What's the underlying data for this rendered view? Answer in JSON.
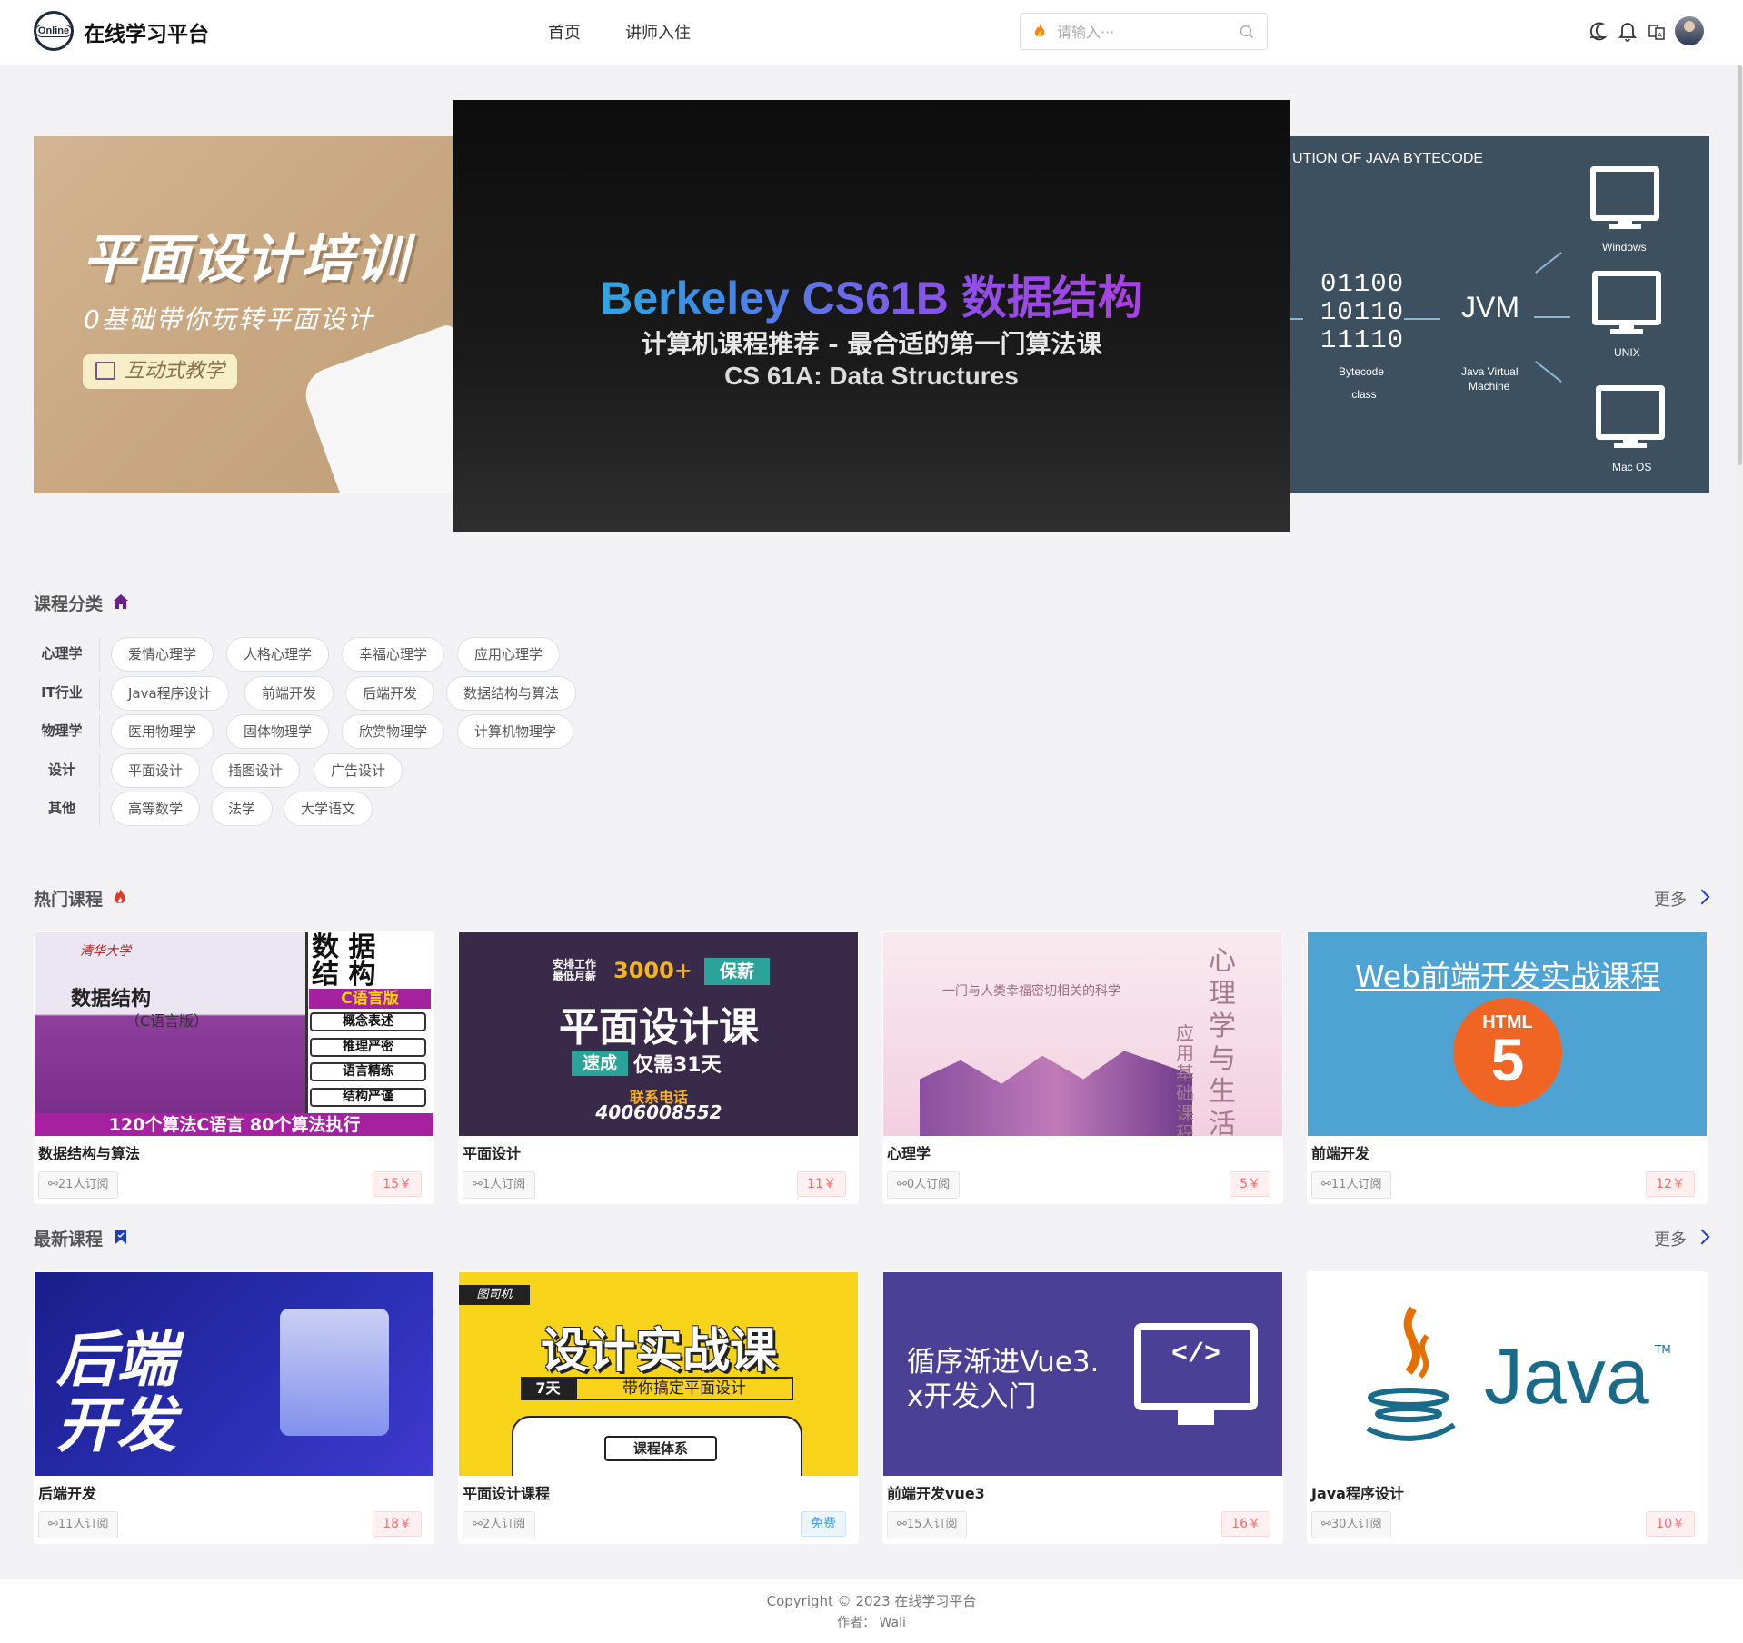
{
  "header": {
    "logo_text": "Online",
    "site_title": "在线学习平台",
    "nav": {
      "home": "首页",
      "teacher": "讲师入住"
    },
    "search_placeholder": "请输入···"
  },
  "carousel": {
    "left": {
      "title": "平面设计培训",
      "subtitle": "0基础带你玩转平面设计",
      "badge": "互动式教学"
    },
    "center": {
      "title": "Berkeley CS61B 数据结构",
      "line2": "计算机课程推荐 - 最合适的第一门算法课",
      "line3": "CS 61A: Data Structures"
    },
    "right": {
      "title": "UTION OF JAVA BYTECODE",
      "bits": [
        "01100",
        "10110",
        "11110"
      ],
      "bytecode": "Bytecode",
      "class": ".class",
      "jvm": "JVM",
      "jvm_sub": "Java Virtual",
      "jvm_sub2": "Machine",
      "os": [
        "Windows",
        "UNIX",
        "Mac OS"
      ]
    }
  },
  "categories": {
    "title": "课程分类",
    "rows": [
      {
        "name": "心理学",
        "tags": [
          "爱情心理学",
          "人格心理学",
          "幸福心理学",
          "应用心理学"
        ]
      },
      {
        "name": "IT行业",
        "tags": [
          "Java程序设计",
          "前端开发",
          "后端开发",
          "数据结构与算法"
        ]
      },
      {
        "name": "物理学",
        "tags": [
          "医用物理学",
          "固体物理学",
          "欣赏物理学",
          "计算机物理学"
        ]
      },
      {
        "name": "设计",
        "tags": [
          "平面设计",
          "插图设计",
          "广告设计"
        ]
      },
      {
        "name": "其他",
        "tags": [
          "高等数学",
          "法学",
          "大学语文"
        ]
      }
    ]
  },
  "hot": {
    "title": "热门课程",
    "more": "更多",
    "courses": [
      {
        "name": "数据结构与算法",
        "subs": "21人订阅",
        "price": "15￥",
        "img": {
          "banner": "120个算法C语言  80个算法执行",
          "big": "数 据\n结 构",
          "sub": "C语言版",
          "tags": [
            "概念表述",
            "推理严密",
            "语言精练",
            "结构严谨"
          ],
          "book": "数据结构",
          "book_sub": "（C语言版）",
          "pub": "清华大学"
        }
      },
      {
        "name": "平面设计",
        "subs": "1人订阅",
        "price": "11￥",
        "img": {
          "top1": "安排工作",
          "top2": "最低月薪",
          "top3": "3000+",
          "top4": "保薪",
          "main": "平面设计课",
          "speed": "速成",
          "days": "仅需31天",
          "phone_label": "联系电话",
          "phone": "4006008552"
        }
      },
      {
        "name": "心理学",
        "subs": "0人订阅",
        "price": "5￥",
        "img": {
          "line": "一门与人类幸福密切相关的科学",
          "v1": "心理学与生活",
          "v2": "应用基础课程"
        }
      },
      {
        "name": "前端开发",
        "subs": "11人订阅",
        "price": "12￥",
        "img": {
          "title": "Web前端开发实战课程",
          "html": "HTML",
          "five": "5"
        }
      }
    ]
  },
  "latest": {
    "title": "最新课程",
    "more": "更多",
    "courses": [
      {
        "name": "后端开发",
        "subs": "11人订阅",
        "price": "18￥",
        "img": {
          "t1": "后端",
          "t2": "开发"
        }
      },
      {
        "name": "平面设计课程",
        "subs": "2人订阅",
        "price": "免费",
        "img": {
          "brand": "图司机",
          "main": "设计实战课",
          "days": "7天",
          "sub": "带你搞定平面设计",
          "sys": "课程体系"
        }
      },
      {
        "name": "前端开发vue3",
        "subs": "15人订阅",
        "price": "16￥",
        "img": {
          "l1": "循序渐进Vue3.",
          "l2": "x开发入门",
          "code": "</>"
        }
      },
      {
        "name": "Java程序设计",
        "subs": "30人订阅",
        "price": "10￥",
        "img": {
          "java": "Java",
          "tm": "TM"
        }
      }
    ]
  },
  "footer": {
    "copyright": "Copyright © 2023 在线学习平台",
    "author": "作者：  Wali"
  },
  "colors": {
    "accent": "#1f3fbf",
    "price": "#f56c6c",
    "free": "#409eff",
    "hot_icon": "#e03a2a",
    "home_icon": "#6a1f8a"
  }
}
